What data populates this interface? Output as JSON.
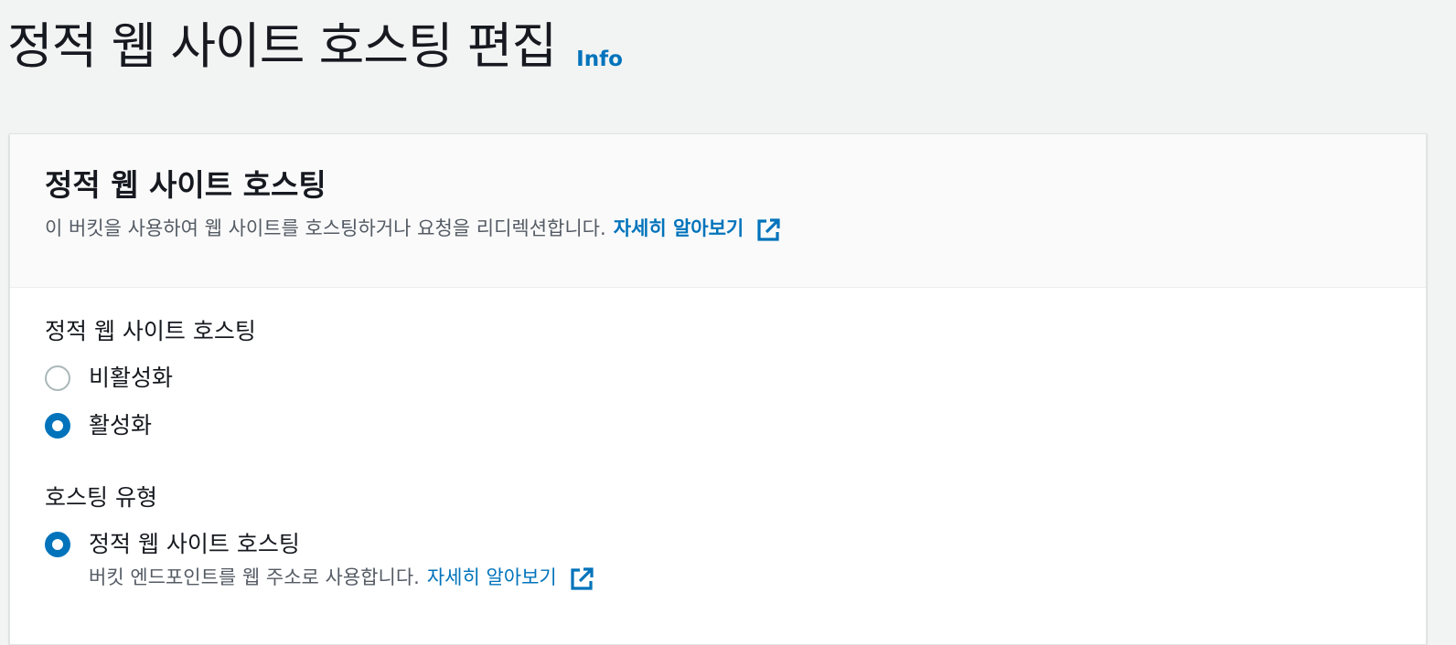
{
  "header": {
    "title": "정적 웹 사이트 호스팅 편집",
    "info_link": "Info"
  },
  "panel": {
    "title": "정적 웹 사이트 호스팅",
    "description": "이 버킷을 사용하여 웹 사이트를 호스팅하거나 요청을 리디렉션합니다.",
    "learn_more": "자세히 알아보기",
    "external_icon": "external-link-icon"
  },
  "hosting_toggle": {
    "label": "정적 웹 사이트 호스팅",
    "options": [
      {
        "label": "비활성화",
        "selected": false
      },
      {
        "label": "활성화",
        "selected": true
      }
    ]
  },
  "hosting_type": {
    "label": "호스팅 유형",
    "options": [
      {
        "label": "정적 웹 사이트 호스팅",
        "selected": true,
        "description": "버킷 엔드포인트를 웹 주소로 사용합니다.",
        "learn_more": "자세히 알아보기"
      }
    ]
  },
  "colors": {
    "accent": "#0073bb",
    "background": "#f2f3f3",
    "text": "#16191f",
    "secondary_text": "#545b64"
  }
}
